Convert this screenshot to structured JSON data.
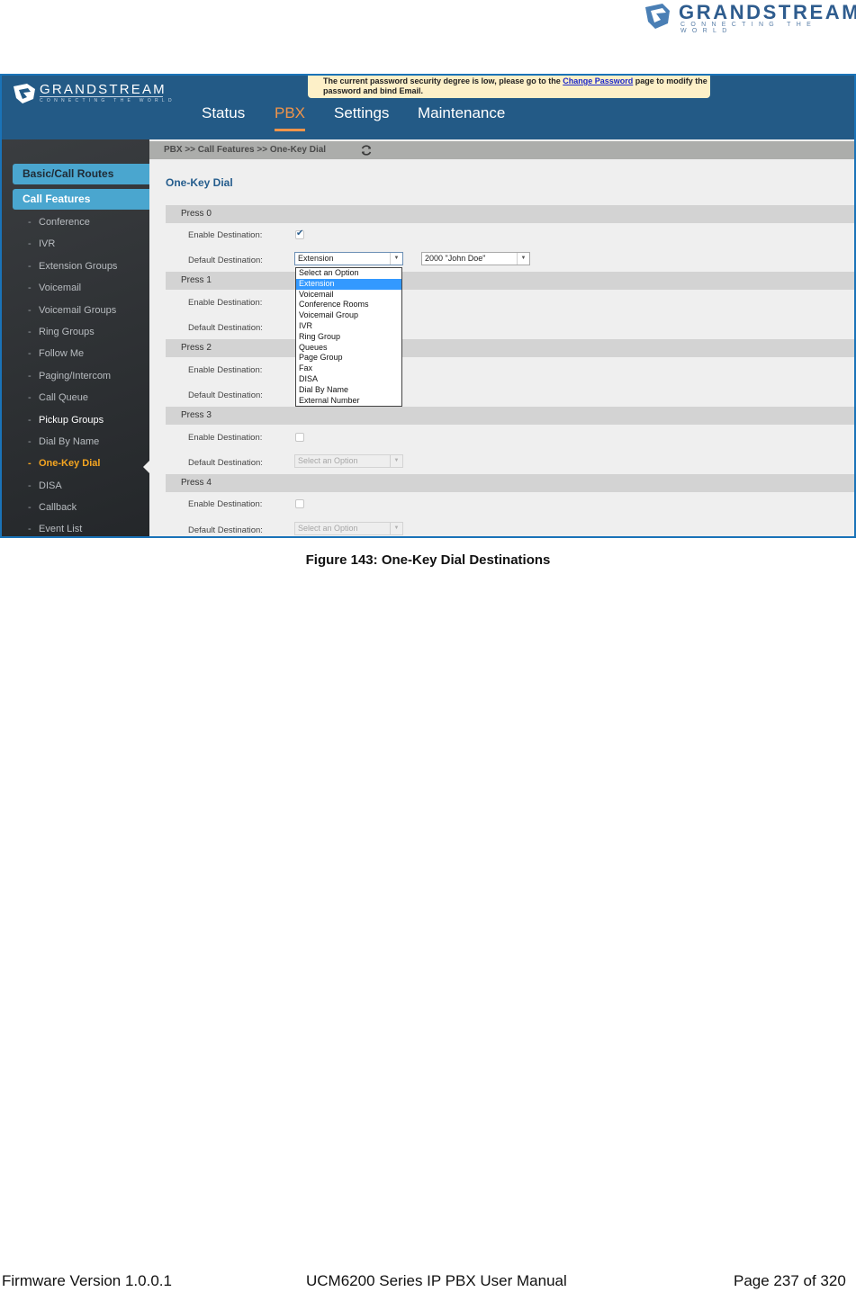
{
  "doc_header": {
    "logo_word": "GRANDSTREAM",
    "logo_tagline": "CONNECTING THE WORLD"
  },
  "app": {
    "logo_word": "GRANDSTREAM",
    "logo_tagline": "CONNECTING THE WORLD",
    "notice": {
      "text_before": "The current password security degree is low, please go to the ",
      "link": "Change Password",
      "text_after": " page to modify the password and bind Email."
    },
    "nav": [
      {
        "label": "Status",
        "active": false
      },
      {
        "label": "PBX",
        "active": true
      },
      {
        "label": "Settings",
        "active": false
      },
      {
        "label": "Maintenance",
        "active": false
      }
    ],
    "sidebar": {
      "sections": [
        "Basic/Call Routes",
        "Call Features"
      ],
      "items": [
        {
          "label": "Conference",
          "state": "normal"
        },
        {
          "label": "IVR",
          "state": "normal"
        },
        {
          "label": "Extension Groups",
          "state": "normal"
        },
        {
          "label": "Voicemail",
          "state": "normal"
        },
        {
          "label": "Voicemail Groups",
          "state": "normal"
        },
        {
          "label": "Ring Groups",
          "state": "normal"
        },
        {
          "label": "Follow Me",
          "state": "normal"
        },
        {
          "label": "Paging/Intercom",
          "state": "normal"
        },
        {
          "label": "Call Queue",
          "state": "normal"
        },
        {
          "label": "Pickup Groups",
          "state": "highlight"
        },
        {
          "label": "Dial By Name",
          "state": "normal"
        },
        {
          "label": "One-Key Dial",
          "state": "active"
        },
        {
          "label": "DISA",
          "state": "normal"
        },
        {
          "label": "Callback",
          "state": "normal"
        },
        {
          "label": "Event List",
          "state": "normal"
        }
      ]
    },
    "breadcrumb": "PBX >> Call Features >> One-Key Dial",
    "page_title": "One-Key Dial",
    "labels": {
      "enable": "Enable Destination:",
      "default": "Default Destination:"
    },
    "presses": [
      {
        "title": "Press 0",
        "enabled": true,
        "destination": "Extension",
        "target": "2000 \"John Doe\""
      },
      {
        "title": "Press 1",
        "enabled": false,
        "destination": ""
      },
      {
        "title": "Press 2",
        "enabled": false,
        "destination": ""
      },
      {
        "title": "Press 3",
        "enabled": false,
        "destination": "Select an Option"
      },
      {
        "title": "Press 4",
        "enabled": false,
        "destination": "Select an Option"
      }
    ],
    "dropdown_options": [
      "Select an Option",
      "Extension",
      "Voicemail",
      "Conference Rooms",
      "Voicemail Group",
      "IVR",
      "Ring Group",
      "Queues",
      "Page Group",
      "Fax",
      "DISA",
      "Dial By Name",
      "External Number"
    ],
    "dropdown_selected": "Extension"
  },
  "caption": "Figure 143: One-Key Dial Destinations",
  "footer": {
    "left": "Firmware Version 1.0.0.1",
    "center": "UCM6200 Series IP PBX User Manual",
    "right": "Page 237 of 320"
  }
}
